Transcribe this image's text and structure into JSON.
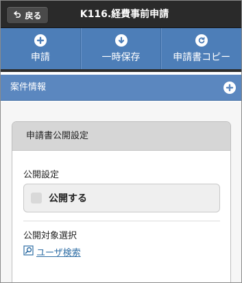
{
  "header": {
    "back_label": "戻る",
    "title": "K116.経費事前申請"
  },
  "toolbar": {
    "buttons": [
      {
        "label": "申請",
        "icon": "plus-icon"
      },
      {
        "label": "一時保存",
        "icon": "arrow-down-icon"
      },
      {
        "label": "申請書コピー",
        "icon": "refresh-icon"
      }
    ]
  },
  "section": {
    "title": "案件情報",
    "toggle_icon": "plus-icon"
  },
  "card": {
    "title": "申請書公開設定",
    "visibility_label": "公開設定",
    "visibility_option": "公開する",
    "target_label": "公開対象選択",
    "user_search_label": "ユーザ検索"
  },
  "colors": {
    "header_bg": "#2a2a2a",
    "toolbar_bg": "#4d7eb8",
    "section_bg": "#5b87bf",
    "link": "#2e6da4"
  }
}
